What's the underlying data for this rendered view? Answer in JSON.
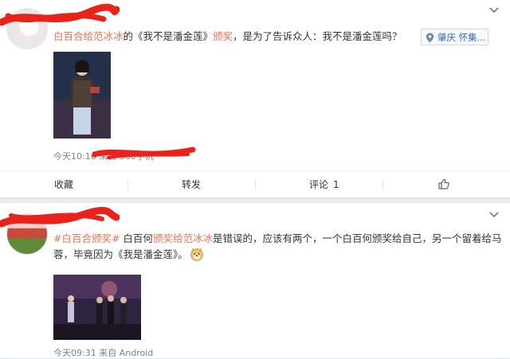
{
  "post1": {
    "mention": "白百合给范冰冰",
    "text_a": "的《我不是潘金莲》",
    "topic": "颁奖",
    "text_b": "，是为了告诉众人：我不是潘金莲吗？",
    "location": "肇庆 怀集...",
    "meta_time": "今天10:16 来自 360手机",
    "actions": {
      "favorite": "收藏",
      "repost": "转发",
      "comment": "评论",
      "comment_count": "1"
    }
  },
  "post2": {
    "hashtag": "#白百合颁奖#",
    "text_a": " 白百何",
    "link": "颁奖给范冰冰",
    "text_b": "是错误的，应该有两个，一个白百何颁奖给自己，另一个留着给马蓉，毕竟因为《我是潘金莲》。",
    "meta_time": "今天09:31 来自 Android"
  },
  "icons": [
    "chevron-down-icon",
    "location-pin-icon",
    "thumb-up-icon",
    "doge-emoji-icon"
  ],
  "colors": {
    "accent": "#eb7350",
    "link_blue": "#3c6db3",
    "background": "#e9edf2"
  }
}
